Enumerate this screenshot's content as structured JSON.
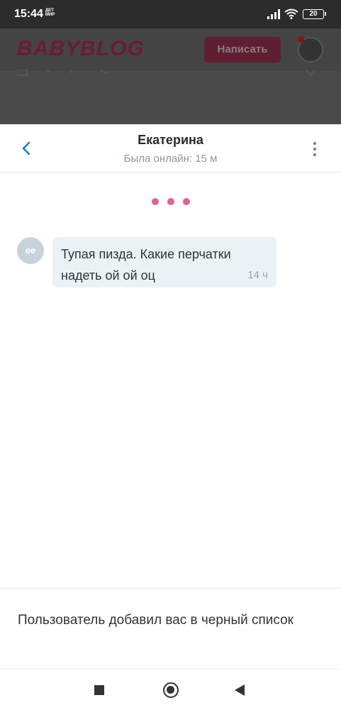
{
  "status_bar": {
    "time": "15:44",
    "carrier_label": "ДЕТ МИР",
    "battery_level": "20"
  },
  "background_site": {
    "logo": "BABYBLOG",
    "write_button": "Написать"
  },
  "chat": {
    "contact_name": "Екатерина",
    "contact_status": "Была онлайн: 15 м",
    "messages": [
      {
        "avatar_initials": "ее",
        "text": "Тупая пизда. Какие перчатки надеть ой ой оц",
        "time": "14 ч"
      }
    ],
    "blacklist_notice": "Пользователь добавил вас в черный список"
  },
  "colors": {
    "accent_blue": "#1e7ac6",
    "typing_dot": "#e0629a",
    "bubble_bg": "#eaf2f6",
    "brand": "#6b1c33"
  }
}
